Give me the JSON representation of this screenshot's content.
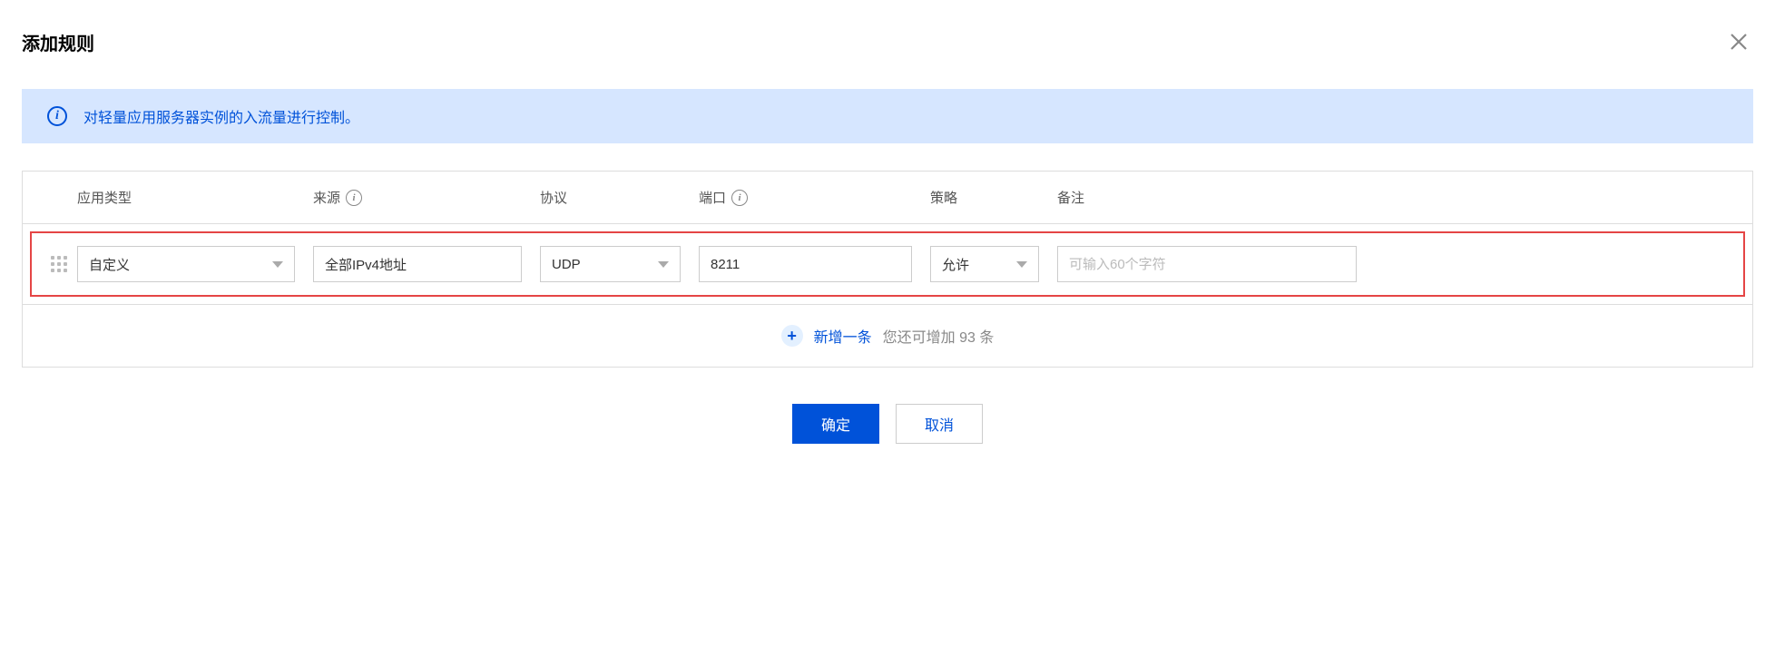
{
  "header": {
    "title": "添加规则"
  },
  "banner": {
    "text": "对轻量应用服务器实例的入流量进行控制。"
  },
  "table": {
    "columns": {
      "app_type": "应用类型",
      "source": "来源",
      "protocol": "协议",
      "port": "端口",
      "policy": "策略",
      "remark": "备注"
    },
    "row": {
      "app_type": "自定义",
      "source": "全部IPv4地址",
      "protocol": "UDP",
      "port": "8211",
      "policy": "允许",
      "remark_placeholder": "可输入60个字符"
    }
  },
  "add": {
    "label": "新增一条",
    "hint": "您还可增加 93 条"
  },
  "footer": {
    "confirm": "确定",
    "cancel": "取消"
  }
}
